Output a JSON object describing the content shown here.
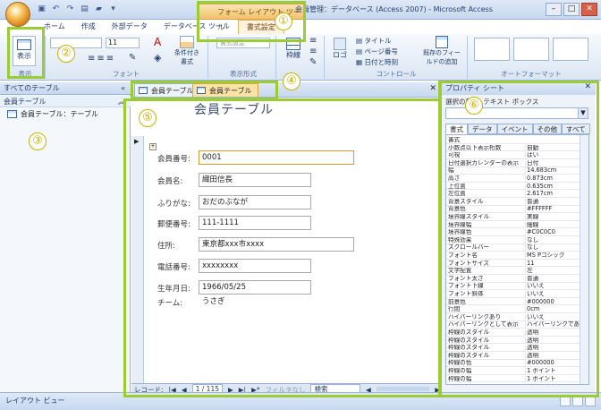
{
  "window": {
    "title": "会員管理：データベース (Access 2007) - Microsoft Access",
    "contextual_tab_group": "フォーム レイアウト ツール"
  },
  "ribbon_tabs": [
    "ホーム",
    "作成",
    "外部データ",
    "データベース ツール",
    "書式設定"
  ],
  "ribbon": {
    "view_label": "表示",
    "view_group": "表示",
    "font_group": "フォント",
    "font_size": "11",
    "conditional_format": "条件付き書式",
    "number_format_group": "表示形式",
    "number_format_placeholder": "書式設定",
    "gridlines": "枠線",
    "controls_group": "コントロール",
    "logo": "ロゴ",
    "title": "タイトル",
    "page_number": "ページ番号",
    "date_time": "日付と時刻",
    "add_existing_fields": "既存のフィールドの追加",
    "autoformat_group": "オートフォーマット"
  },
  "nav_pane": {
    "header": "すべてのテーブル",
    "group": "会員テーブル",
    "item": "会員テーブル：テーブル"
  },
  "doc_tabs": [
    "会員テーブル",
    "会員テーブル"
  ],
  "form": {
    "title": "会員テーブル",
    "fields": [
      {
        "label": "会員番号:",
        "value": "0001"
      },
      {
        "label": "会員名:",
        "value": "織田信長"
      },
      {
        "label": "ふりがな:",
        "value": "おだのぶなが"
      },
      {
        "label": "郵便番号:",
        "value": "111-1111"
      },
      {
        "label": "住所:",
        "value": "東京都xxx市xxxx"
      },
      {
        "label": "電話番号:",
        "value": "xxxxxxxx"
      },
      {
        "label": "生年月日:",
        "value": "1966/05/25"
      },
      {
        "label": "チーム:",
        "value": "うさぎ"
      }
    ]
  },
  "record_nav": {
    "label": "レコード:",
    "position": "1 / 115",
    "filter": "フィルタなし",
    "search": "検索"
  },
  "property_sheet": {
    "title": "プロパティ シート",
    "selection_type": "選択の種類: テキスト ボックス",
    "tabs": [
      "書式",
      "データ",
      "イベント",
      "その他",
      "すべて"
    ],
    "rows": [
      {
        "k": "書式",
        "v": ""
      },
      {
        "k": "小数点以下表示桁数",
        "v": "自動"
      },
      {
        "k": "可視",
        "v": "はい"
      },
      {
        "k": "日付選択カレンダーの表示",
        "v": "日付"
      },
      {
        "k": "幅",
        "v": "14.683cm"
      },
      {
        "k": "高さ",
        "v": "0.873cm"
      },
      {
        "k": "上位置",
        "v": "0.635cm"
      },
      {
        "k": "左位置",
        "v": "2.617cm"
      },
      {
        "k": "背景スタイル",
        "v": "普通"
      },
      {
        "k": "背景色",
        "v": "#FFFFFF"
      },
      {
        "k": "境界線スタイル",
        "v": "実線"
      },
      {
        "k": "境界線幅",
        "v": "細線"
      },
      {
        "k": "境界線色",
        "v": "#C0C0C0"
      },
      {
        "k": "特殊効果",
        "v": "なし"
      },
      {
        "k": "スクロールバー",
        "v": "なし"
      },
      {
        "k": "フォント名",
        "v": "MS Pゴシック"
      },
      {
        "k": "フォントサイズ",
        "v": "11"
      },
      {
        "k": "文字配置",
        "v": "左"
      },
      {
        "k": "フォント太さ",
        "v": "普通"
      },
      {
        "k": "フォント下線",
        "v": "いいえ"
      },
      {
        "k": "フォント斜体",
        "v": "いいえ"
      },
      {
        "k": "前景色",
        "v": "#000000"
      },
      {
        "k": "行間",
        "v": "0cm"
      },
      {
        "k": "ハイパーリンクあり",
        "v": "いいえ"
      },
      {
        "k": "ハイパーリンクとして表示",
        "v": "ハイパーリンクであ"
      },
      {
        "k": "枠線のスタイル",
        "v": "透明"
      },
      {
        "k": "枠線のスタイル",
        "v": "透明"
      },
      {
        "k": "枠線のスタイル",
        "v": "透明"
      },
      {
        "k": "枠線のスタイル",
        "v": "透明"
      },
      {
        "k": "枠線の色",
        "v": "#000000"
      },
      {
        "k": "枠線の幅",
        "v": "1 ポイント"
      },
      {
        "k": "枠線の幅",
        "v": "1 ポイント"
      }
    ]
  },
  "status": {
    "text": "レイアウト ビュー"
  },
  "callouts": [
    "①",
    "②",
    "③",
    "④",
    "⑤",
    "⑥"
  ],
  "colors": {
    "highlight": "#9ccc33",
    "callout": "#c9b000"
  }
}
